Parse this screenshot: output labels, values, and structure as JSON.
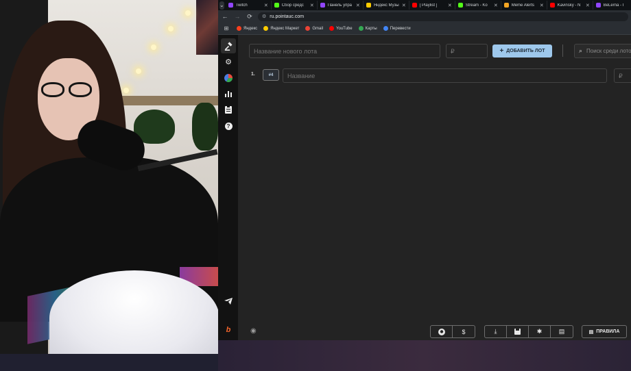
{
  "browser": {
    "tab_menu_icon": "chevron-down-icon",
    "tabs": [
      {
        "title": "Twitch",
        "color": "#9146ff"
      },
      {
        "title": "Сбор средс",
        "color": "#53fc18"
      },
      {
        "title": "Панель упра",
        "color": "#9146ff"
      },
      {
        "title": "Яндекс Музы",
        "color": "#ffcc00"
      },
      {
        "title": "[ Playlist ]",
        "color": "#ff0000"
      },
      {
        "title": "Stream - Ko",
        "color": "#53fc18"
      },
      {
        "title": "Meme Alerts",
        "color": "#f5a623"
      },
      {
        "title": "Kavinsky - N",
        "color": "#ff0000"
      },
      {
        "title": "BeLerna - I",
        "color": "#9146ff"
      }
    ],
    "url": "ru.pointauc.com",
    "bookmarks": [
      {
        "label": "Яндекс",
        "color": "#fc3f1d"
      },
      {
        "label": "Яндекс Маркет",
        "color": "#ffcc00"
      },
      {
        "label": "Gmail",
        "color": "#ea4335"
      },
      {
        "label": "YouTube",
        "color": "#ff0000"
      },
      {
        "label": "Карты",
        "color": "#34a853"
      },
      {
        "label": "Перевести",
        "color": "#4285f4"
      }
    ]
  },
  "app": {
    "sidebar": [
      "gavel-icon",
      "gear-icon",
      "pie-chart-icon",
      "bar-chart-icon",
      "clipboard-icon",
      "help-icon",
      "telegram-icon",
      "logo-icon"
    ],
    "new_lot_placeholder": "Название нового лота",
    "price_placeholder": "₽",
    "add_button_label": "ДОБАВИТЬ ЛОТ",
    "search_placeholder": "Поиск среди лотов",
    "lots": [
      {
        "num": "1.",
        "id": "#4",
        "name_placeholder": "Название",
        "price_placeholder": "₽"
      }
    ],
    "rules_label": "ПРАВИЛА",
    "accent_color": "#9ec8ec"
  }
}
